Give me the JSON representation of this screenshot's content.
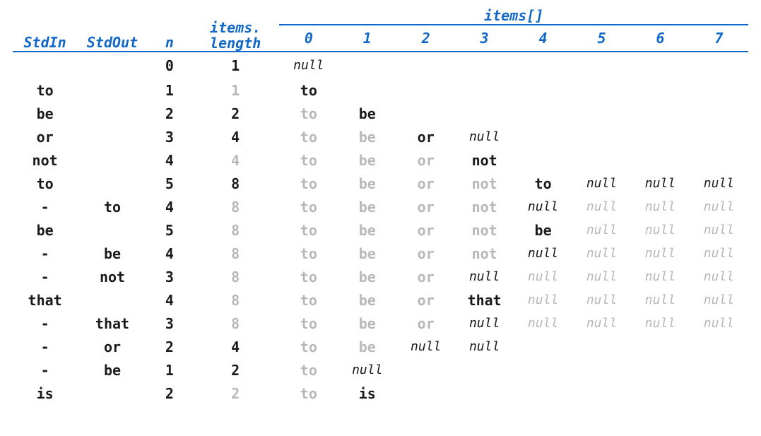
{
  "headers": {
    "stdin": "StdIn",
    "stdout": "StdOut",
    "n": "n",
    "length_line1": "items.",
    "length_line2": "length",
    "items_group": "items[]",
    "indices": [
      "0",
      "1",
      "2",
      "3",
      "4",
      "5",
      "6",
      "7"
    ]
  },
  "null_label": "null",
  "rows": [
    {
      "stdin": "",
      "stdout": "",
      "n": "0",
      "len": "1",
      "len_dim": false,
      "cells": [
        {
          "t": "null",
          "dim": false
        }
      ]
    },
    {
      "stdin": "to",
      "stdout": "",
      "n": "1",
      "len": "1",
      "len_dim": true,
      "cells": [
        {
          "t": "to",
          "dim": false
        }
      ]
    },
    {
      "stdin": "be",
      "stdout": "",
      "n": "2",
      "len": "2",
      "len_dim": false,
      "cells": [
        {
          "t": "to",
          "dim": true
        },
        {
          "t": "be",
          "dim": false
        }
      ]
    },
    {
      "stdin": "or",
      "stdout": "",
      "n": "3",
      "len": "4",
      "len_dim": false,
      "cells": [
        {
          "t": "to",
          "dim": true
        },
        {
          "t": "be",
          "dim": true
        },
        {
          "t": "or",
          "dim": false
        },
        {
          "t": "null",
          "dim": false
        }
      ]
    },
    {
      "stdin": "not",
      "stdout": "",
      "n": "4",
      "len": "4",
      "len_dim": true,
      "cells": [
        {
          "t": "to",
          "dim": true
        },
        {
          "t": "be",
          "dim": true
        },
        {
          "t": "or",
          "dim": true
        },
        {
          "t": "not",
          "dim": false
        }
      ]
    },
    {
      "stdin": "to",
      "stdout": "",
      "n": "5",
      "len": "8",
      "len_dim": false,
      "cells": [
        {
          "t": "to",
          "dim": true
        },
        {
          "t": "be",
          "dim": true
        },
        {
          "t": "or",
          "dim": true
        },
        {
          "t": "not",
          "dim": true
        },
        {
          "t": "to",
          "dim": false
        },
        {
          "t": "null",
          "dim": false
        },
        {
          "t": "null",
          "dim": false
        },
        {
          "t": "null",
          "dim": false
        }
      ]
    },
    {
      "stdin": "-",
      "stdout": "to",
      "n": "4",
      "len": "8",
      "len_dim": true,
      "cells": [
        {
          "t": "to",
          "dim": true
        },
        {
          "t": "be",
          "dim": true
        },
        {
          "t": "or",
          "dim": true
        },
        {
          "t": "not",
          "dim": true
        },
        {
          "t": "null",
          "dim": false
        },
        {
          "t": "null",
          "dim": true
        },
        {
          "t": "null",
          "dim": true
        },
        {
          "t": "null",
          "dim": true
        }
      ]
    },
    {
      "stdin": "be",
      "stdout": "",
      "n": "5",
      "len": "8",
      "len_dim": true,
      "cells": [
        {
          "t": "to",
          "dim": true
        },
        {
          "t": "be",
          "dim": true
        },
        {
          "t": "or",
          "dim": true
        },
        {
          "t": "not",
          "dim": true
        },
        {
          "t": "be",
          "dim": false
        },
        {
          "t": "null",
          "dim": true
        },
        {
          "t": "null",
          "dim": true
        },
        {
          "t": "null",
          "dim": true
        }
      ]
    },
    {
      "stdin": "-",
      "stdout": "be",
      "n": "4",
      "len": "8",
      "len_dim": true,
      "cells": [
        {
          "t": "to",
          "dim": true
        },
        {
          "t": "be",
          "dim": true
        },
        {
          "t": "or",
          "dim": true
        },
        {
          "t": "not",
          "dim": true
        },
        {
          "t": "null",
          "dim": false
        },
        {
          "t": "null",
          "dim": true
        },
        {
          "t": "null",
          "dim": true
        },
        {
          "t": "null",
          "dim": true
        }
      ]
    },
    {
      "stdin": "-",
      "stdout": "not",
      "n": "3",
      "len": "8",
      "len_dim": true,
      "cells": [
        {
          "t": "to",
          "dim": true
        },
        {
          "t": "be",
          "dim": true
        },
        {
          "t": "or",
          "dim": true
        },
        {
          "t": "null",
          "dim": false
        },
        {
          "t": "null",
          "dim": true
        },
        {
          "t": "null",
          "dim": true
        },
        {
          "t": "null",
          "dim": true
        },
        {
          "t": "null",
          "dim": true
        }
      ]
    },
    {
      "stdin": "that",
      "stdout": "",
      "n": "4",
      "len": "8",
      "len_dim": true,
      "cells": [
        {
          "t": "to",
          "dim": true
        },
        {
          "t": "be",
          "dim": true
        },
        {
          "t": "or",
          "dim": true
        },
        {
          "t": "that",
          "dim": false
        },
        {
          "t": "null",
          "dim": true
        },
        {
          "t": "null",
          "dim": true
        },
        {
          "t": "null",
          "dim": true
        },
        {
          "t": "null",
          "dim": true
        }
      ]
    },
    {
      "stdin": "-",
      "stdout": "that",
      "n": "3",
      "len": "8",
      "len_dim": true,
      "cells": [
        {
          "t": "to",
          "dim": true
        },
        {
          "t": "be",
          "dim": true
        },
        {
          "t": "or",
          "dim": true
        },
        {
          "t": "null",
          "dim": false
        },
        {
          "t": "null",
          "dim": true
        },
        {
          "t": "null",
          "dim": true
        },
        {
          "t": "null",
          "dim": true
        },
        {
          "t": "null",
          "dim": true
        }
      ]
    },
    {
      "stdin": "-",
      "stdout": "or",
      "n": "2",
      "len": "4",
      "len_dim": false,
      "cells": [
        {
          "t": "to",
          "dim": true
        },
        {
          "t": "be",
          "dim": true
        },
        {
          "t": "null",
          "dim": false
        },
        {
          "t": "null",
          "dim": false
        }
      ]
    },
    {
      "stdin": "-",
      "stdout": "be",
      "n": "1",
      "len": "2",
      "len_dim": false,
      "cells": [
        {
          "t": "to",
          "dim": true
        },
        {
          "t": "null",
          "dim": false
        }
      ]
    },
    {
      "stdin": "is",
      "stdout": "",
      "n": "2",
      "len": "2",
      "len_dim": true,
      "cells": [
        {
          "t": "to",
          "dim": true
        },
        {
          "t": "is",
          "dim": false
        }
      ]
    }
  ]
}
